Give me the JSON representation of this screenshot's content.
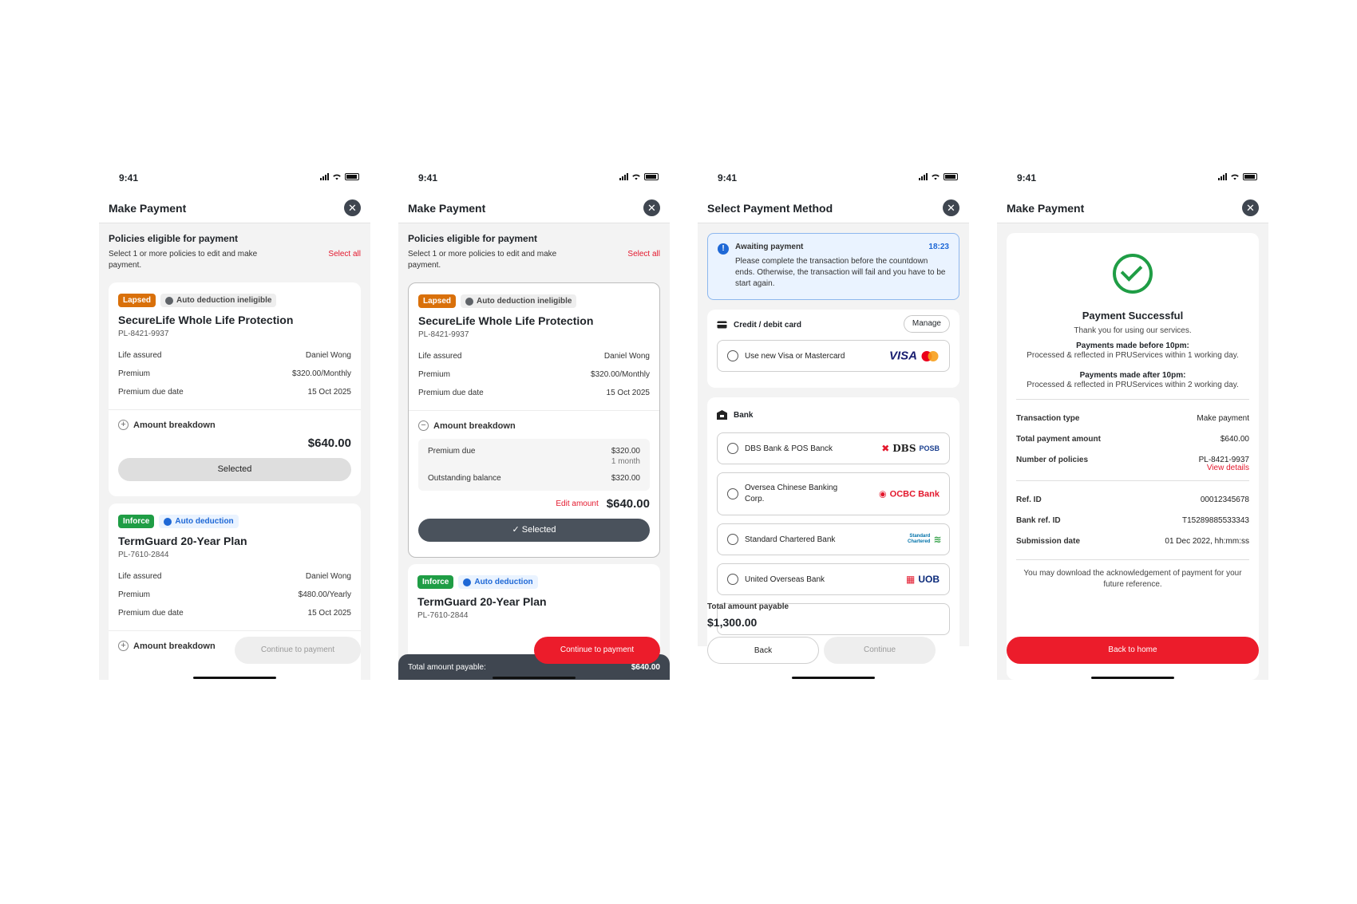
{
  "status_time": "9:41",
  "colors": {
    "brand_red": "#ec1c2b",
    "lapsed": "#d9700a",
    "inforce": "#1f9d45",
    "info_blue": "#1e68d6"
  },
  "screen1": {
    "title": "Make Payment",
    "section_title": "Policies eligible for payment",
    "section_sub": "Select 1 or more policies to edit and make payment.",
    "select_all": "Select all",
    "policy1": {
      "tag_status": "Lapsed",
      "tag_auto": "Auto deduction ineligible",
      "name": "SecureLife Whole Life Protection",
      "number": "PL-8421-9937",
      "rows": [
        {
          "label": "Life assured",
          "value": "Daniel Wong"
        },
        {
          "label": "Premium",
          "value": "$320.00/Monthly"
        },
        {
          "label": "Premium due date",
          "value": "15 Oct 2025"
        }
      ],
      "breakdown_label": "Amount breakdown",
      "amount": "$640.00",
      "selected_label": "Selected"
    },
    "policy2": {
      "tag_status": "Inforce",
      "tag_auto": "Auto deduction",
      "name": "TermGuard 20-Year Plan",
      "number": "PL-7610-2844",
      "rows": [
        {
          "label": "Life assured",
          "value": "Daniel Wong"
        },
        {
          "label": "Premium",
          "value": "$480.00/Yearly"
        },
        {
          "label": "Premium due date",
          "value": "15 Oct 2025"
        }
      ],
      "breakdown_label": "Amount breakdown"
    },
    "continue_label": "Continue to payment"
  },
  "screen2": {
    "title": "Make Payment",
    "section_title": "Policies eligible for payment",
    "section_sub": "Select 1 or more policies to edit and make payment.",
    "select_all": "Select all",
    "policy1": {
      "tag_status": "Lapsed",
      "tag_auto": "Auto deduction ineligible",
      "name": "SecureLife Whole Life Protection",
      "number": "PL-8421-9937",
      "rows": [
        {
          "label": "Life assured",
          "value": "Daniel Wong"
        },
        {
          "label": "Premium",
          "value": "$320.00/Monthly"
        },
        {
          "label": "Premium due date",
          "value": "15 Oct 2025"
        }
      ],
      "breakdown_label": "Amount breakdown",
      "premium_due_label": "Premium due",
      "premium_due_value": "$320.00",
      "premium_due_sub": "1 month",
      "outstanding_label": "Outstanding balance",
      "outstanding_value": "$320.00",
      "edit_amount": "Edit amount",
      "amount": "$640.00",
      "selected_label": "Selected"
    },
    "policy2": {
      "tag_status": "Inforce",
      "tag_auto": "Auto deduction",
      "name": "TermGuard 20-Year Plan",
      "number": "PL-7610-2844"
    },
    "total_label": "Total amount payable:",
    "total_value": "$640.00",
    "continue_label": "Continue to payment"
  },
  "screen3": {
    "title": "Select Payment Method",
    "awaiting_title": "Awaiting payment",
    "countdown": "18:23",
    "awaiting_text": "Please complete the transaction before the countdown ends. Otherwise, the transaction will fail and you have to be start again.",
    "card_section": "Credit / debit card",
    "manage": "Manage",
    "new_card": "Use new Visa or Mastercard",
    "visa_logo": "VISA",
    "bank_section": "Bank",
    "banks": [
      {
        "name": "DBS Bank & POS Banck",
        "logo": "DBS",
        "logo2": "POSB"
      },
      {
        "name": "Oversea Chinese Banking Corp.",
        "logo": "OCBC Bank"
      },
      {
        "name": "Standard Chartered Bank",
        "logo": "Standard Chartered"
      },
      {
        "name": "United Overseas Bank",
        "logo": "UOB"
      }
    ],
    "total_label": "Total amount payable",
    "total_value": "$1,300.00",
    "back_label": "Back",
    "continue_label": "Continue"
  },
  "screen4": {
    "title": "Make Payment",
    "success_title": "Payment Successful",
    "success_sub": "Thank you for using our services.",
    "before_title": "Payments made before 10pm:",
    "before_text": "Processed & reflected in PRUServices within 1 working day.",
    "after_title": "Payments made after 10pm:",
    "after_text": "Processed & reflected in PRUServices within 2 working day.",
    "details": [
      {
        "label": "Transaction type",
        "value": "Make payment"
      },
      {
        "label": "Total payment amount",
        "value": "$640.00"
      },
      {
        "label": "Number of policies",
        "value": "PL-8421-9937"
      }
    ],
    "view_details": "View details",
    "refs": [
      {
        "label": "Ref. ID",
        "value": "00012345678"
      },
      {
        "label": "Bank ref. ID",
        "value": "T15289885533343"
      },
      {
        "label": "Submission date",
        "value": "01 Dec 2022, hh:mm:ss"
      }
    ],
    "download_note": "You may download the acknowledgement of payment for your future reference.",
    "back_home": "Back to home"
  }
}
